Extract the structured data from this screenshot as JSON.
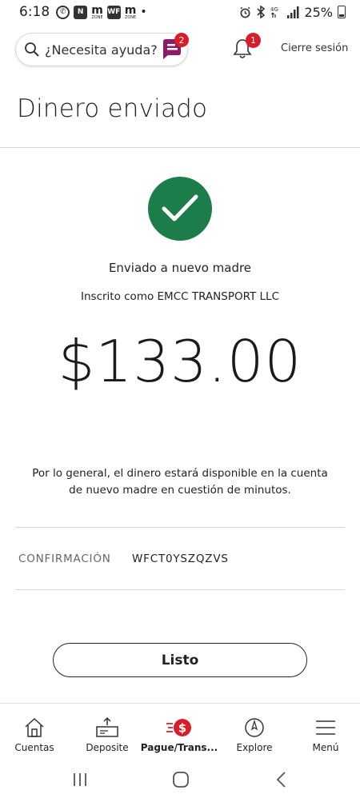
{
  "status_bar": {
    "time": "6:18",
    "battery": "25%",
    "network": "4G"
  },
  "header": {
    "search_placeholder": "¿Necesita ayuda?",
    "chat_badge": "2",
    "notification_badge": "1",
    "logout_label": "Cierre sesión"
  },
  "page": {
    "title": "Dinero enviado"
  },
  "confirmation": {
    "sent_to": "Enviado a nuevo madre",
    "enrolled_as": "Inscrito como EMCC TRANSPORT LLC",
    "amount": "$133.00",
    "availability_line1": "Por lo general, el dinero estará disponible en la cuenta",
    "availability_line2": "de nuevo madre en cuestión de minutos.",
    "confirmation_label": "CONFIRMACIÓN",
    "confirmation_number": "WFCT0YSZQZVS",
    "done_label": "Listo"
  },
  "bottom_nav": {
    "items": [
      {
        "label": "Cuentas",
        "icon": "home-icon"
      },
      {
        "label": "Deposite",
        "icon": "deposit-icon"
      },
      {
        "label": "Pague/Trans...",
        "icon": "pay-transfer-icon"
      },
      {
        "label": "Explore",
        "icon": "compass-icon"
      },
      {
        "label": "Menú",
        "icon": "menu-icon"
      }
    ]
  },
  "colors": {
    "success_green": "#1c7d4a",
    "badge_red": "#d71e28",
    "chat_purple": "#8a1a6a"
  }
}
